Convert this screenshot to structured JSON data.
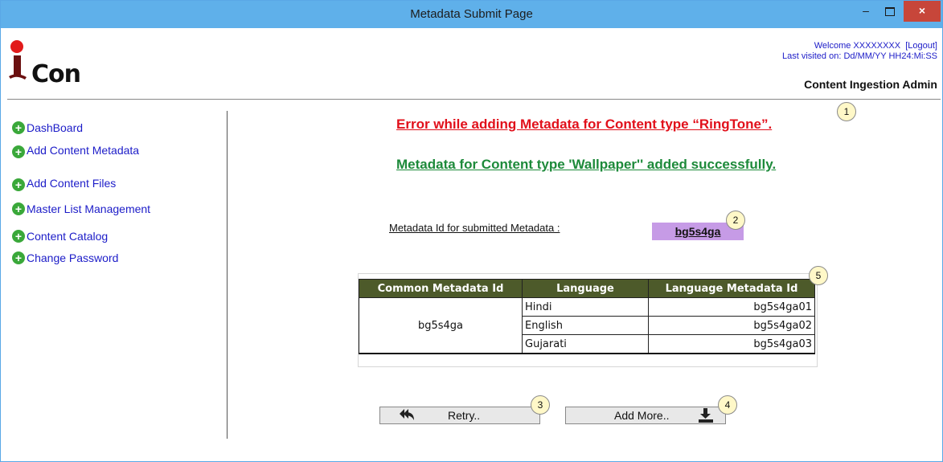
{
  "window": {
    "title": "Metadata Submit Page",
    "min_label": "–",
    "close_label": "×"
  },
  "header": {
    "logo_text": "Con",
    "welcome": "Welcome XXXXXXXX",
    "logout": "[Logout]",
    "last_visited": "Last visited on: Dd/MM/YY HH24:Mi:SS",
    "role": "Content Ingestion Admin"
  },
  "sidebar": {
    "items": [
      {
        "label": "DashBoard"
      },
      {
        "label": "Add Content Metadata"
      },
      {
        "label": "Add Content Files"
      },
      {
        "label": "Master List Management"
      },
      {
        "label": "Content Catalog"
      },
      {
        "label": "Change Password"
      }
    ]
  },
  "main": {
    "error_message": "Error while adding Metadata for Content type “RingTone”.",
    "success_message": "Metadata for Content type 'Wallpaper'' added successfully.",
    "metadata_label": "Metadata Id for submitted Metadata :",
    "metadata_id": "bg5s4ga",
    "table": {
      "headers": [
        "Common Metadata Id",
        "Language",
        "Language Metadata Id"
      ],
      "common_id": "bg5s4ga",
      "rows": [
        {
          "language": "Hindi",
          "lang_id": "bg5s4ga01"
        },
        {
          "language": "English",
          "lang_id": "bg5s4ga02"
        },
        {
          "language": "Gujarati",
          "lang_id": "bg5s4ga03"
        }
      ]
    },
    "buttons": {
      "retry": "Retry..",
      "add_more": "Add More.."
    },
    "callouts": [
      "1",
      "2",
      "3",
      "4",
      "5"
    ]
  },
  "colors": {
    "titlebar": "#5fb0ea",
    "error": "#e1101b",
    "success": "#1d8a3a",
    "link": "#1c1cc8",
    "table_header": "#4d5a2a",
    "id_highlight": "#c69be6",
    "nav_icon": "#3aa83a"
  },
  "icons": {
    "nav": "plus-circle-icon",
    "retry": "reply-all-icon",
    "add_more": "download-icon"
  }
}
